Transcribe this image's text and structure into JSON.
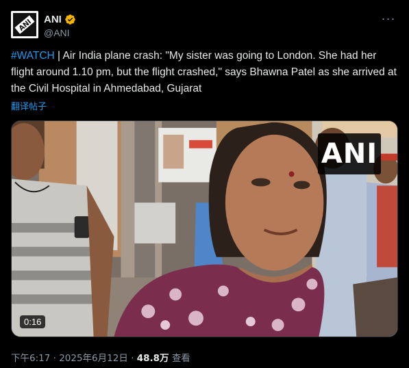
{
  "author": {
    "display_name": "ANI",
    "handle": "@ANI",
    "avatar_icon": "ani-logo-icon",
    "verified_icon": "verified-badge-icon"
  },
  "more_icon": "more-options-icon",
  "tweet": {
    "hashtag": "#WATCH",
    "body": " | Air India plane crash: \"My sister was going to London. She had her flight around 1.10 pm, but the flight crashed,\" says Bhawna Patel as she arrived at the Civil Hospital in Ahmedabad, Gujarat",
    "translate_label": "翻译帖子"
  },
  "video": {
    "watermark": "ANI",
    "duration": "0:16"
  },
  "meta": {
    "time": "下午6:17",
    "separator": " · ",
    "date": "2025年6月12日",
    "views": "48.8万",
    "views_label": "查看"
  },
  "colors": {
    "background": "#000000",
    "link": "#1d9bf0",
    "muted": "#8b98a5",
    "verified": "#f4b400"
  }
}
